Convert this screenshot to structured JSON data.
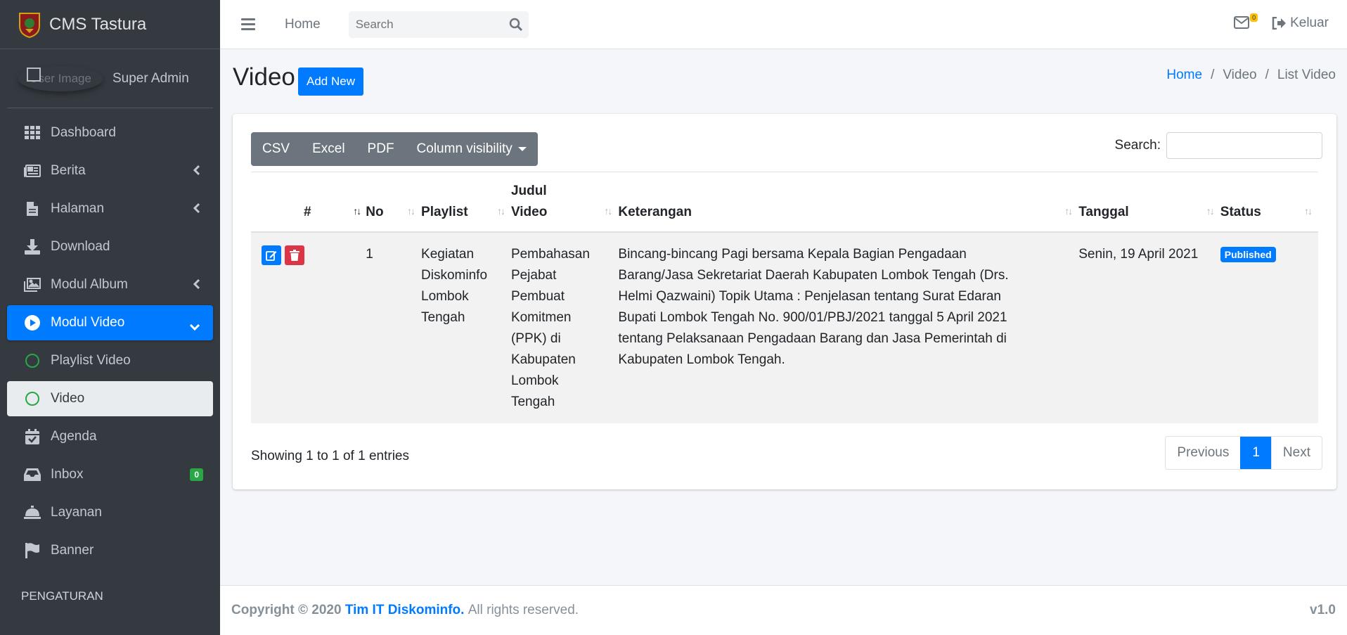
{
  "brand": {
    "title": "CMS Tastura"
  },
  "user": {
    "image_alt": "User Image",
    "name": "Super Admin"
  },
  "sidebar": {
    "items": [
      {
        "label": "Dashboard",
        "icon": "dashboard-icon"
      },
      {
        "label": "Berita",
        "icon": "newspaper-icon",
        "has_arrow": true
      },
      {
        "label": "Halaman",
        "icon": "file-icon",
        "has_arrow": true
      },
      {
        "label": "Download",
        "icon": "download-icon"
      },
      {
        "label": "Modul Album",
        "icon": "images-icon",
        "has_arrow": true
      },
      {
        "label": "Modul Video",
        "icon": "play-circle-icon",
        "active": true
      },
      {
        "label": "Playlist Video",
        "icon": "circle-icon"
      },
      {
        "label": "Video",
        "icon": "circle-icon",
        "current": true
      },
      {
        "label": "Agenda",
        "icon": "calendar-check-icon"
      },
      {
        "label": "Inbox",
        "icon": "inbox-icon",
        "badge": "0"
      },
      {
        "label": "Layanan",
        "icon": "bell-concierge-icon"
      },
      {
        "label": "Banner",
        "icon": "flag-icon"
      }
    ],
    "header": "PENGATURAN"
  },
  "topbar": {
    "home": "Home",
    "search_placeholder": "Search",
    "mail_badge": "0",
    "logout": "Keluar"
  },
  "page": {
    "title": "Video",
    "add_new": "Add New",
    "breadcrumb": [
      "Home",
      "Video",
      "List Video"
    ]
  },
  "table": {
    "buttons": [
      "CSV",
      "Excel",
      "PDF",
      "Column visibility"
    ],
    "search_label": "Search:",
    "headers": [
      "#",
      "",
      "No",
      "Playlist",
      "Judul Video",
      "Keterangan",
      "Tanggal",
      "Status"
    ],
    "rows": [
      {
        "no": "1",
        "playlist": "Kegiatan Diskominfo Lombok Tengah",
        "judul": "Pembahasan Pejabat Pembuat Komitmen (PPK) di Kabupaten Lombok Tengah",
        "keterangan": "Bincang-bincang Pagi bersama Kepala Bagian Pengadaan Barang/Jasa Sekretariat Daerah Kabupaten Lombok Tengah (Drs. Helmi Qazwaini) Topik Utama : Penjelasan tentang Surat Edaran Bupati Lombok Tengah No. 900/01/PBJ/2021 tanggal 5 April 2021 tentang Pelaksanaan Pengadaan Barang dan Jasa Pemerintah di Kabupaten Lombok Tengah.",
        "tanggal": "Senin, 19 April 2021",
        "status": "Published"
      }
    ],
    "info": "Showing 1 to 1 of 1 entries",
    "pagination": {
      "previous": "Previous",
      "current": "1",
      "next": "Next"
    }
  },
  "footer": {
    "copyright": "Copyright © 2020",
    "org": "Tim IT Diskominfo.",
    "rights": "All rights reserved.",
    "version": "v1.0"
  },
  "colors": {
    "primary": "#007bff",
    "danger": "#dc3545",
    "sidebar": "#343a40",
    "success": "#28a745",
    "warning": "#ffc107"
  }
}
